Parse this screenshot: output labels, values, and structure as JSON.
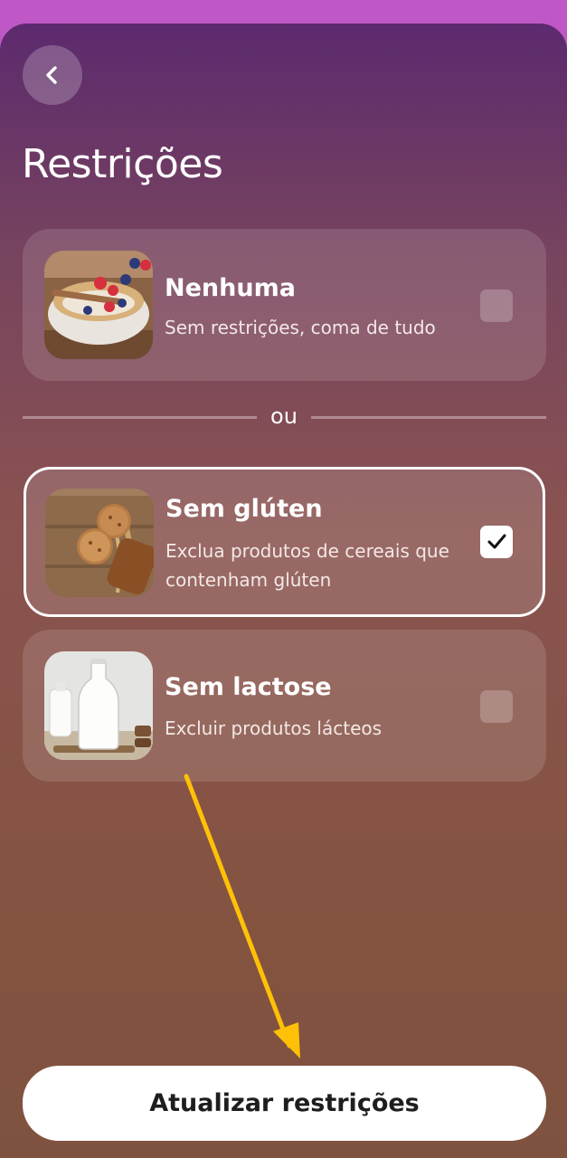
{
  "header": {
    "back_icon": "chevron-left-icon",
    "title": "Restrições"
  },
  "options": [
    {
      "title": "Nenhuma",
      "subtitle": "Sem restrições, coma de tudo",
      "image": "bowl-of-granola-with-berries",
      "checked": false
    },
    {
      "title": "Sem glúten",
      "subtitle": "Exclua produtos de cereais que contenham glúten",
      "image": "cookies-and-bread-on-wood",
      "checked": true
    },
    {
      "title": "Sem lactose",
      "subtitle": "Excluir produtos lácteos",
      "image": "milk-bottles",
      "checked": false
    }
  ],
  "separator": {
    "label": "ou"
  },
  "annotation": {
    "arrow_color": "#ffc107"
  },
  "footer": {
    "button_label": "Atualizar restrições"
  },
  "colors": {
    "top_bar": "#c057c6",
    "sheet_top": "#5c2a6e",
    "sheet_bottom": "#7f5240",
    "button_bg": "#ffffff"
  }
}
